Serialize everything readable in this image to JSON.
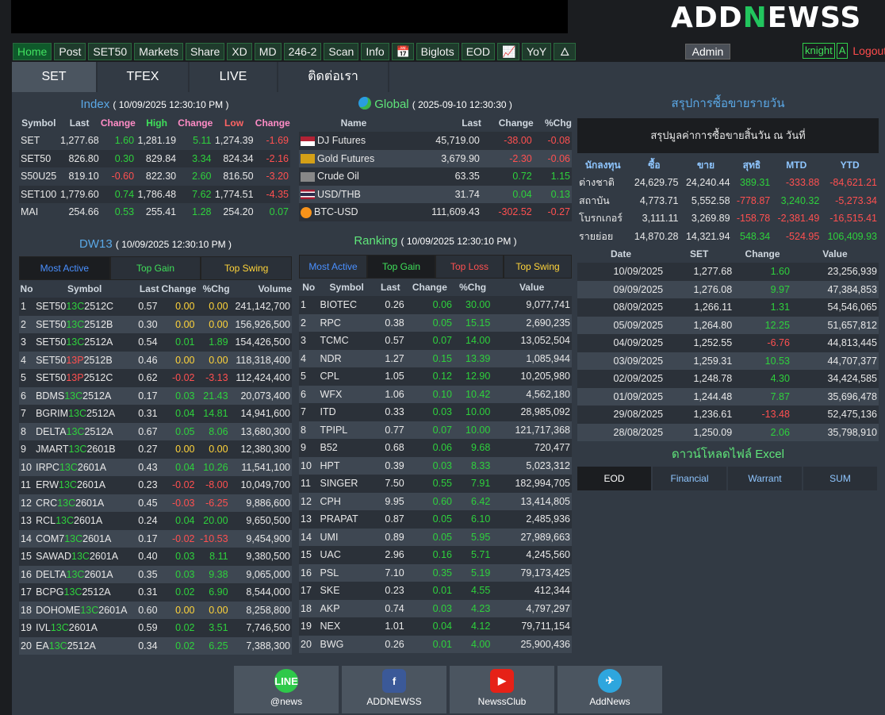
{
  "logo": {
    "pre": "ADD",
    "n": "N",
    "post": "EWSS"
  },
  "nav": [
    "Home",
    "Post",
    "SET50",
    "Markets",
    "Share",
    "XD",
    "MD",
    "246-2",
    "Scan",
    "Info",
    "📅",
    "Biglots",
    "EOD",
    "📈",
    "YoY",
    "🜂"
  ],
  "admin": "Admin",
  "user": {
    "name": "knight",
    "badge": "A",
    "logout": "Logout"
  },
  "tabs": [
    "SET",
    "TFEX",
    "LIVE",
    "ติดต่อเรา"
  ],
  "index": {
    "title": "Index",
    "ts": "( 10/09/2025 12:30:10 PM )",
    "headers": [
      "Symbol",
      "Last",
      "Change",
      "High",
      "Change",
      "Low",
      "Change"
    ],
    "rows": [
      [
        "SET",
        "1,277.68",
        "1.60",
        "1,281.19",
        "5.11",
        "1,274.39",
        "-1.69"
      ],
      [
        "SET50",
        "826.80",
        "0.30",
        "829.84",
        "3.34",
        "824.34",
        "-2.16"
      ],
      [
        "S50U25",
        "819.10",
        "-0.60",
        "822.30",
        "2.60",
        "816.50",
        "-3.20"
      ],
      [
        "SET100",
        "1,779.60",
        "0.74",
        "1,786.48",
        "7.62",
        "1,774.51",
        "-4.35"
      ],
      [
        "MAI",
        "254.66",
        "0.53",
        "255.41",
        "1.28",
        "254.20",
        "0.07"
      ]
    ]
  },
  "global": {
    "title": "Global",
    "ts": "( 2025-09-10 12:30:30 )",
    "headers": [
      "Name",
      "Last",
      "Change",
      "%Chg"
    ],
    "rows": [
      [
        "DJ Futures",
        "45,719.00",
        "-38.00",
        "-0.08"
      ],
      [
        "Gold Futures",
        "3,679.90",
        "-2.30",
        "-0.06"
      ],
      [
        "Crude Oil",
        "63.35",
        "0.72",
        "1.15"
      ],
      [
        "USD/THB",
        "31.74",
        "0.04",
        "0.13"
      ],
      [
        "BTC-USD",
        "111,609.43",
        "-302.52",
        "-0.27"
      ]
    ]
  },
  "summary": {
    "title": "สรุปการซื้อขายรายวัน",
    "subtitle": "สรุปมูลค่าการซื้อขายสิ้นวัน ณ วันที่",
    "headers": [
      "นักลงทุน",
      "ซื้อ",
      "ขาย",
      "สุทธิ",
      "MTD",
      "YTD"
    ],
    "rows": [
      [
        "ต่างชาติ",
        "24,629.75",
        "24,240.44",
        "389.31",
        "-333.88",
        "-84,621.21"
      ],
      [
        "สถาบัน",
        "4,773.71",
        "5,552.58",
        "-778.87",
        "3,240.32",
        "-5,273.34"
      ],
      [
        "โบรกเกอร์",
        "3,111.11",
        "3,269.89",
        "-158.78",
        "-2,381.49",
        "-16,515.41"
      ],
      [
        "รายย่อย",
        "14,870.28",
        "14,321.94",
        "548.34",
        "-524.95",
        "106,409.93"
      ]
    ],
    "hist_headers": [
      "Date",
      "SET",
      "Change",
      "Value"
    ],
    "hist": [
      [
        "10/09/2025",
        "1,277.68",
        "1.60",
        "23,256,939"
      ],
      [
        "09/09/2025",
        "1,276.08",
        "9.97",
        "47,384,853"
      ],
      [
        "08/09/2025",
        "1,266.11",
        "1.31",
        "54,546,065"
      ],
      [
        "05/09/2025",
        "1,264.80",
        "12.25",
        "51,657,812"
      ],
      [
        "04/09/2025",
        "1,252.55",
        "-6.76",
        "44,813,445"
      ],
      [
        "03/09/2025",
        "1,259.31",
        "10.53",
        "44,707,377"
      ],
      [
        "02/09/2025",
        "1,248.78",
        "4.30",
        "34,424,585"
      ],
      [
        "01/09/2025",
        "1,244.48",
        "7.87",
        "35,696,478"
      ],
      [
        "29/08/2025",
        "1,236.61",
        "-13.48",
        "52,475,136"
      ],
      [
        "28/08/2025",
        "1,250.09",
        "2.06",
        "35,798,910"
      ]
    ],
    "dl_title": "ดาวน์โหลดไฟล์ Excel",
    "dl_tabs": [
      "EOD",
      "Financial",
      "Warrant",
      "SUM"
    ]
  },
  "dw": {
    "title": "DW13",
    "ts": "( 10/09/2025 12:30:10 PM )",
    "tabs": [
      "Most Active",
      "Top Gain",
      "Top Swing"
    ],
    "headers": [
      "No",
      "Symbol",
      "Last",
      "Change",
      "%Chg",
      "Volume"
    ],
    "rows": [
      [
        "1",
        "SET50",
        "13C",
        "2512C",
        "0.57",
        "0.00",
        "0.00",
        "241,142,700"
      ],
      [
        "2",
        "SET50",
        "13C",
        "2512B",
        "0.30",
        "0.00",
        "0.00",
        "156,926,500"
      ],
      [
        "3",
        "SET50",
        "13C",
        "2512A",
        "0.54",
        "0.01",
        "1.89",
        "154,426,500"
      ],
      [
        "4",
        "SET50",
        "13P",
        "2512B",
        "0.46",
        "0.00",
        "0.00",
        "118,318,400"
      ],
      [
        "5",
        "SET50",
        "13P",
        "2512C",
        "0.62",
        "-0.02",
        "-3.13",
        "112,424,400"
      ],
      [
        "6",
        "BDMS",
        "13C",
        "2512A",
        "0.17",
        "0.03",
        "21.43",
        "20,073,400"
      ],
      [
        "7",
        "BGRIM",
        "13C",
        "2512A",
        "0.31",
        "0.04",
        "14.81",
        "14,941,600"
      ],
      [
        "8",
        "DELTA",
        "13C",
        "2512A",
        "0.67",
        "0.05",
        "8.06",
        "13,680,300"
      ],
      [
        "9",
        "JMART",
        "13C",
        "2601B",
        "0.27",
        "0.00",
        "0.00",
        "12,380,300"
      ],
      [
        "10",
        "IRPC",
        "13C",
        "2601A",
        "0.43",
        "0.04",
        "10.26",
        "11,541,100"
      ],
      [
        "11",
        "ERW",
        "13C",
        "2601A",
        "0.23",
        "-0.02",
        "-8.00",
        "10,049,700"
      ],
      [
        "12",
        "CRC",
        "13C",
        "2601A",
        "0.45",
        "-0.03",
        "-6.25",
        "9,886,600"
      ],
      [
        "13",
        "RCL",
        "13C",
        "2601A",
        "0.24",
        "0.04",
        "20.00",
        "9,650,500"
      ],
      [
        "14",
        "COM7",
        "13C",
        "2601A",
        "0.17",
        "-0.02",
        "-10.53",
        "9,454,900"
      ],
      [
        "15",
        "SAWAD",
        "13C",
        "2601A",
        "0.40",
        "0.03",
        "8.11",
        "9,380,500"
      ],
      [
        "16",
        "DELTA",
        "13C",
        "2601A",
        "0.35",
        "0.03",
        "9.38",
        "9,065,000"
      ],
      [
        "17",
        "BCPG",
        "13C",
        "2512A",
        "0.31",
        "0.02",
        "6.90",
        "8,544,000"
      ],
      [
        "18",
        "DOHOME",
        "13C",
        "2601A",
        "0.60",
        "0.00",
        "0.00",
        "8,258,800"
      ],
      [
        "19",
        "IVL",
        "13C",
        "2601A",
        "0.59",
        "0.02",
        "3.51",
        "7,746,500"
      ],
      [
        "20",
        "EA",
        "13C",
        "2512A",
        "0.34",
        "0.02",
        "6.25",
        "7,388,300"
      ]
    ]
  },
  "ranking": {
    "title": "Ranking",
    "ts": "( 10/09/2025 12:30:10 PM )",
    "tabs": [
      "Most Active",
      "Top Gain",
      "Top Loss",
      "Top Swing"
    ],
    "headers": [
      "No",
      "Symbol",
      "Last",
      "Change",
      "%Chg",
      "Value"
    ],
    "rows": [
      [
        "1",
        "BIOTEC",
        "0.26",
        "0.06",
        "30.00",
        "9,077,741"
      ],
      [
        "2",
        "RPC",
        "0.38",
        "0.05",
        "15.15",
        "2,690,235"
      ],
      [
        "3",
        "TCMC",
        "0.57",
        "0.07",
        "14.00",
        "13,052,504"
      ],
      [
        "4",
        "NDR",
        "1.27",
        "0.15",
        "13.39",
        "1,085,944"
      ],
      [
        "5",
        "CPL",
        "1.05",
        "0.12",
        "12.90",
        "10,205,980"
      ],
      [
        "6",
        "WFX",
        "1.06",
        "0.10",
        "10.42",
        "4,562,180"
      ],
      [
        "7",
        "ITD",
        "0.33",
        "0.03",
        "10.00",
        "28,985,092"
      ],
      [
        "8",
        "TPIPL",
        "0.77",
        "0.07",
        "10.00",
        "121,717,368"
      ],
      [
        "9",
        "B52",
        "0.68",
        "0.06",
        "9.68",
        "720,477"
      ],
      [
        "10",
        "HPT",
        "0.39",
        "0.03",
        "8.33",
        "5,023,312"
      ],
      [
        "11",
        "SINGER",
        "7.50",
        "0.55",
        "7.91",
        "182,994,705"
      ],
      [
        "12",
        "CPH",
        "9.95",
        "0.60",
        "6.42",
        "13,414,805"
      ],
      [
        "13",
        "PRAPAT",
        "0.87",
        "0.05",
        "6.10",
        "2,485,936"
      ],
      [
        "14",
        "UMI",
        "0.89",
        "0.05",
        "5.95",
        "27,989,663"
      ],
      [
        "15",
        "UAC",
        "2.96",
        "0.16",
        "5.71",
        "4,245,560"
      ],
      [
        "16",
        "PSL",
        "7.10",
        "0.35",
        "5.19",
        "79,173,425"
      ],
      [
        "17",
        "SKE",
        "0.23",
        "0.01",
        "4.55",
        "412,344"
      ],
      [
        "18",
        "AKP",
        "0.74",
        "0.03",
        "4.23",
        "4,797,297"
      ],
      [
        "19",
        "NEX",
        "1.01",
        "0.04",
        "4.12",
        "79,711,154"
      ],
      [
        "20",
        "BWG",
        "0.26",
        "0.01",
        "4.00",
        "25,900,436"
      ]
    ]
  },
  "social": [
    {
      "label": "@news",
      "icon": "LINE",
      "color": "#2ec94a"
    },
    {
      "label": "ADDNEWSS",
      "icon": "f",
      "color": "#3b5998"
    },
    {
      "label": "NewssClub",
      "icon": "▶",
      "color": "#e62117"
    },
    {
      "label": "AddNews",
      "icon": "✈",
      "color": "#2ea6de"
    }
  ]
}
